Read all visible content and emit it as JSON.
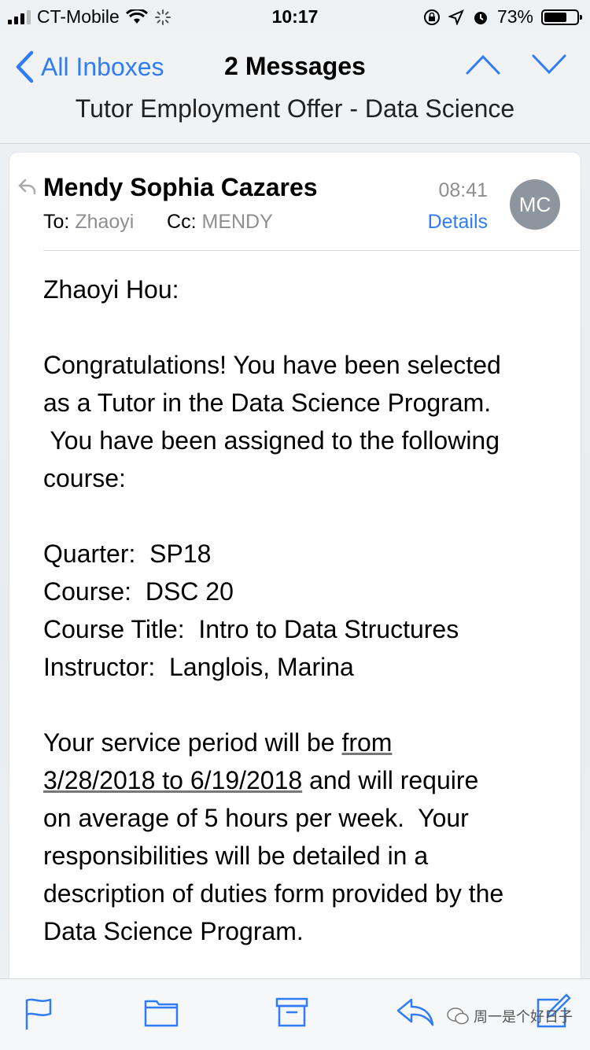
{
  "status_bar": {
    "carrier": "CT-Mobile",
    "time": "10:17",
    "battery": "73%",
    "battery_level": 0.73
  },
  "nav": {
    "back_label": "All Inboxes",
    "message_count": "2 Messages",
    "subject": "Tutor Employment Offer - Data Science"
  },
  "message": {
    "sender": "Mendy Sophia Cazares",
    "to_label": "To:",
    "to_value": "Zhaoyi",
    "cc_label": "Cc:",
    "cc_value": "MENDY",
    "time": "08:41",
    "details_label": "Details",
    "avatar_initials": "MC",
    "body": {
      "greeting": "Zhaoyi Hou:",
      "para1_line1": "Congratulations!  You have been selected",
      "para1_line2": "as a Tutor in the Data Science Program.",
      "para1_line3": " You have been assigned to the following",
      "para1_line4": "course:",
      "quarter": "Quarter:  SP18",
      "course": "Course:  DSC 20",
      "course_title": "Course Title:  Intro to Data Structures",
      "instructor": "Instructor:  Langlois, Marina",
      "para3_line1_a": "Your service period will be ",
      "para3_line1_b": "from",
      "para3_line2_a": "3/28/2018 to 6/19/2018",
      "para3_line2_b": " and will require",
      "para3_line3": "on average of 5 hours per week.  Your",
      "para3_line4": "responsibilities will be detailed in a",
      "para3_line5": "description of duties form provided by the",
      "para3_line6": "Data Science Program."
    }
  },
  "toolbar": {
    "icons": [
      "flag-icon",
      "folder-icon",
      "archive-icon",
      "reply-icon",
      "compose-icon"
    ]
  },
  "watermark": {
    "text": "周一是个好日子"
  },
  "colors": {
    "accent": "#2f7cf6",
    "secondary_text": "#8e8e93",
    "avatar_bg": "#8d959f"
  }
}
